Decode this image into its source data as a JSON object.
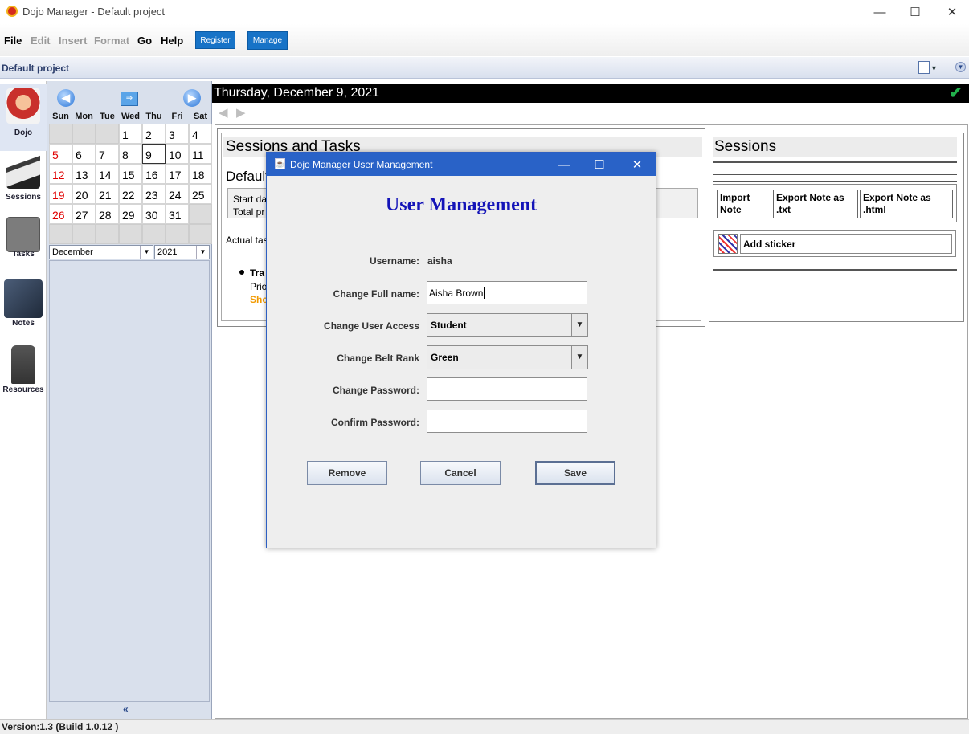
{
  "window": {
    "title": "Dojo Manager - Default project",
    "minimize": "—",
    "maximize": "☐",
    "close": "✕"
  },
  "menu": {
    "items": [
      "File",
      "Edit",
      "Insert",
      "Format",
      "Go",
      "Help"
    ],
    "register_label": "Register",
    "manage_label": "Manage"
  },
  "project": {
    "name": "Default project"
  },
  "sidebar": {
    "items": [
      {
        "label": "Dojo",
        "icon": "dojo-mascot-icon"
      },
      {
        "label": "Sessions",
        "icon": "karate-kick-icon"
      },
      {
        "label": "Tasks",
        "icon": "task-check-icon"
      },
      {
        "label": "Notes",
        "icon": "notes-icon"
      },
      {
        "label": "Resources",
        "icon": "gi-uniform-icon"
      }
    ]
  },
  "calendar": {
    "day_headers": [
      "Sun",
      "Mon",
      "Tue",
      "Wed",
      "Thu",
      "Fri",
      "Sat"
    ],
    "weeks": [
      [
        "",
        "",
        "",
        "1",
        "2",
        "3",
        "4"
      ],
      [
        "5",
        "6",
        "7",
        "8",
        "9",
        "10",
        "11"
      ],
      [
        "12",
        "13",
        "14",
        "15",
        "16",
        "17",
        "18"
      ],
      [
        "19",
        "20",
        "21",
        "22",
        "23",
        "24",
        "25"
      ],
      [
        "26",
        "27",
        "28",
        "29",
        "30",
        "31",
        ""
      ],
      [
        "",
        "",
        "",
        "",
        "",
        "",
        ""
      ]
    ],
    "selected_day": "9",
    "month": "December",
    "year": "2021",
    "collapse_icon": "«"
  },
  "main": {
    "date": "Thursday, December 9, 2021",
    "checkmark": "✔",
    "back_arrow": "◀",
    "forward_arrow": "▶",
    "tasks": {
      "title": "Sessions and Tasks",
      "project_label": "Default",
      "start_date_partial": "Start da",
      "total_partial": "Total pr",
      "actual_tasks_partial": "Actual tas",
      "task_name_partial": "Tra",
      "task_priority_partial": "Prio",
      "task_show_partial": "Sho"
    },
    "sessions": {
      "title": "Sessions",
      "import_note": "Import Note",
      "export_txt": "Export Note as .txt",
      "export_html": "Export Note as .html",
      "add_sticker": "Add sticker"
    }
  },
  "dialog": {
    "title": "Dojo Manager User Management",
    "heading": "User Management",
    "username_label": "Username:",
    "username_value": "aisha",
    "full_name_label": "Change Full name:",
    "full_name_value": "Aisha Brown",
    "access_label": "Change User Access",
    "access_value": "Student",
    "belt_label": "Change Belt Rank",
    "belt_value": "Green",
    "password_label": "Change Password:",
    "password_value": "",
    "confirm_label": "Confirm Password:",
    "confirm_value": "",
    "remove_label": "Remove",
    "cancel_label": "Cancel",
    "save_label": "Save"
  },
  "status": {
    "version": "Version:1.3 (Build 1.0.12 )"
  },
  "colors": {
    "dialog_titlebar": "#2962c7",
    "heading_blue": "#1414b8",
    "manage_blue": "#1773c7",
    "sunday_red": "#e00000",
    "show_orange": "#f29a00",
    "check_green": "#22b14c"
  }
}
